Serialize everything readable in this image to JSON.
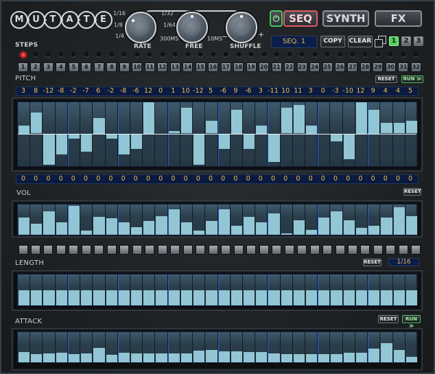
{
  "logo": {
    "letters": [
      "M",
      "U",
      "T",
      "A",
      "T",
      "E"
    ]
  },
  "knobs": {
    "rate": {
      "label": "RATE",
      "ticks": [
        "1/16",
        "1/8",
        "1/4",
        "1/32",
        "1/64"
      ]
    },
    "free": {
      "label": "FREE",
      "min": "300MS",
      "max": "10MS"
    },
    "shuffle": {
      "label": "SHUFFLE",
      "min": "−",
      "max": "+"
    }
  },
  "tabs": {
    "seq": "SEQ",
    "synth": "SYNTH",
    "fx": "FX",
    "active": "SEQ"
  },
  "seq": {
    "name": "SEQ. 1",
    "copy": "COPY",
    "clear": "CLEAR",
    "slots": [
      "1",
      "2",
      "3"
    ],
    "active_slot": "1"
  },
  "steps": {
    "label": "STEPS",
    "count": 32,
    "active_step": 1,
    "numbers": [
      "1",
      "2",
      "3",
      "4",
      "5",
      "6",
      "7",
      "8",
      "9",
      "10",
      "11",
      "12",
      "13",
      "14",
      "15",
      "16",
      "17",
      "18",
      "19",
      "20",
      "21",
      "22",
      "23",
      "24",
      "25",
      "26",
      "27",
      "28",
      "29",
      "30",
      "31",
      "32"
    ]
  },
  "pitch": {
    "label": "PITCH",
    "reset": "RESET",
    "run": "RUN ≫",
    "range": [
      -12,
      12
    ],
    "values": [
      3,
      8,
      -12,
      -8,
      -2,
      -7,
      6,
      -2,
      -8,
      -6,
      12,
      0,
      1,
      10,
      -12,
      5,
      -6,
      9,
      -6,
      3,
      -11,
      10,
      11,
      3,
      0,
      -3,
      -10,
      12,
      9,
      4,
      4,
      5
    ],
    "offsets": [
      0,
      0,
      0,
      0,
      0,
      0,
      0,
      0,
      0,
      0,
      0,
      0,
      0,
      0,
      0,
      0,
      0,
      0,
      0,
      0,
      0,
      0,
      0,
      0,
      0,
      0,
      0,
      0,
      0,
      0,
      0,
      0
    ]
  },
  "vol": {
    "label": "VOL",
    "reset": "RESET",
    "values": [
      0.6,
      0.38,
      0.8,
      0.44,
      1.0,
      0.14,
      0.62,
      0.56,
      0.42,
      0.27,
      0.47,
      0.64,
      0.87,
      0.42,
      0.14,
      0.47,
      0.87,
      0.3,
      0.62,
      0.42,
      0.73,
      0.04,
      0.5,
      0.16,
      0.59,
      0.8,
      0.51,
      0.24,
      0.31,
      0.6,
      0.96,
      0.64
    ]
  },
  "length": {
    "label": "LENGTH",
    "reset": "RESET",
    "division": "1/16",
    "values": [
      0.52,
      0.52,
      0.52,
      0.52,
      0.52,
      0.52,
      0.52,
      0.52,
      0.52,
      0.52,
      0.52,
      0.52,
      0.52,
      0.52,
      0.52,
      0.52,
      0.52,
      0.52,
      0.52,
      0.52,
      0.52,
      0.52,
      0.52,
      0.52,
      0.52,
      0.52,
      0.52,
      0.52,
      0.52,
      0.52,
      0.52,
      0.52
    ]
  },
  "attack": {
    "label": "ATTACK",
    "reset": "RESET",
    "run": "RUN ≫",
    "values": [
      0.36,
      0.29,
      0.31,
      0.33,
      0.29,
      0.31,
      0.51,
      0.27,
      0.33,
      0.31,
      0.31,
      0.31,
      0.31,
      0.31,
      0.4,
      0.44,
      0.38,
      0.38,
      0.36,
      0.36,
      0.31,
      0.29,
      0.29,
      0.29,
      0.29,
      0.29,
      0.33,
      0.33,
      0.47,
      0.67,
      0.42,
      0.18
    ]
  }
}
